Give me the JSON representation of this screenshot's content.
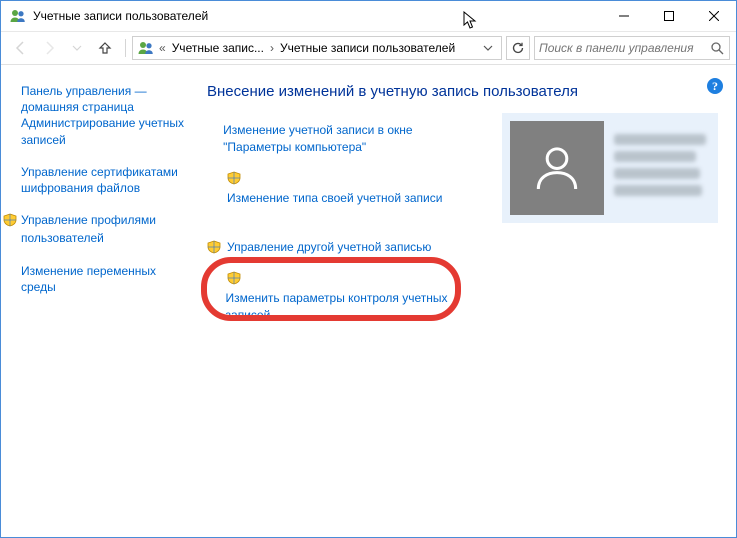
{
  "window": {
    "title": "Учетные записи пользователей"
  },
  "breadcrumb": {
    "seg1": "Учетные запис...",
    "seg2": "Учетные записи пользователей"
  },
  "search": {
    "placeholder": "Поиск в панели управления"
  },
  "sidebar": {
    "home": "Панель управления — домашняя страница",
    "items": [
      "Администрирование учетных записей",
      "Управление сертификатами шифрования файлов",
      "Управление профилями пользователей",
      "Изменение переменных среды"
    ]
  },
  "main": {
    "heading": "Внесение изменений в учетную запись пользователя",
    "tasks": {
      "change_in_settings": "Изменение учетной записи в окне \"Параметры компьютера\"",
      "change_type": "Изменение типа своей учетной записи",
      "manage_other": "Управление другой учетной записью",
      "change_uac": "Изменить параметры контроля учетных записей"
    }
  }
}
